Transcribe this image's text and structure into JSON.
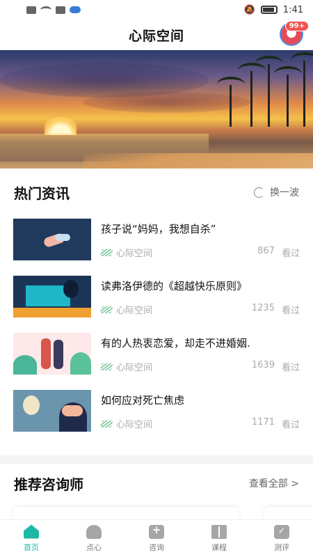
{
  "status_bar": {
    "time": "1:41"
  },
  "app_bar": {
    "title": "心际空间",
    "notification_badge": "99+"
  },
  "hot_news": {
    "title": "热门资讯",
    "refresh_label": "换一波",
    "views_label": "看过",
    "items": [
      {
        "title": "孩子说“妈妈，我想自杀”",
        "source": "心际空间",
        "views": "867"
      },
      {
        "title": "读弗洛伊德的《超越快乐原则》",
        "source": "心际空间",
        "views": "1235"
      },
      {
        "title": "有的人热衷恋爱，却走不进婚姻.",
        "source": "心际空间",
        "views": "1639"
      },
      {
        "title": "如何应对死亡焦虑",
        "source": "心际空间",
        "views": "1171"
      }
    ]
  },
  "recommend": {
    "title": "推荐咨询师",
    "see_all": "查看全部 >"
  },
  "tabs": [
    {
      "label": "首页",
      "icon": "home-icon",
      "active": true
    },
    {
      "label": "点心",
      "icon": "heart-icon",
      "active": false
    },
    {
      "label": "咨询",
      "icon": "chat-icon",
      "active": false
    },
    {
      "label": "课程",
      "icon": "book-icon",
      "active": false
    },
    {
      "label": "测评",
      "icon": "clipboard-icon",
      "active": false
    }
  ],
  "colors": {
    "accent": "#1db7a6",
    "badge": "#f25252"
  }
}
